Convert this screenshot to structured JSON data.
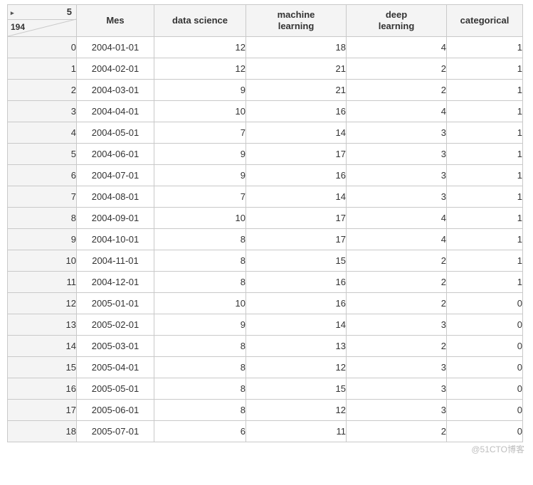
{
  "corner": {
    "tri_glyph": "▸",
    "top_right": "5",
    "row_count": "194"
  },
  "columns": {
    "mes": "Mes",
    "ds": "data science",
    "ml_l1": "machine",
    "ml_l2": "learning",
    "dl_l1": "deep",
    "dl_l2": "learning",
    "cat": "categorical"
  },
  "rows": [
    {
      "idx": "0",
      "mes": "2004-01-01",
      "ds": "12",
      "ml": "18",
      "dl": "4",
      "cat": "1"
    },
    {
      "idx": "1",
      "mes": "2004-02-01",
      "ds": "12",
      "ml": "21",
      "dl": "2",
      "cat": "1"
    },
    {
      "idx": "2",
      "mes": "2004-03-01",
      "ds": "9",
      "ml": "21",
      "dl": "2",
      "cat": "1"
    },
    {
      "idx": "3",
      "mes": "2004-04-01",
      "ds": "10",
      "ml": "16",
      "dl": "4",
      "cat": "1"
    },
    {
      "idx": "4",
      "mes": "2004-05-01",
      "ds": "7",
      "ml": "14",
      "dl": "3",
      "cat": "1"
    },
    {
      "idx": "5",
      "mes": "2004-06-01",
      "ds": "9",
      "ml": "17",
      "dl": "3",
      "cat": "1"
    },
    {
      "idx": "6",
      "mes": "2004-07-01",
      "ds": "9",
      "ml": "16",
      "dl": "3",
      "cat": "1"
    },
    {
      "idx": "7",
      "mes": "2004-08-01",
      "ds": "7",
      "ml": "14",
      "dl": "3",
      "cat": "1"
    },
    {
      "idx": "8",
      "mes": "2004-09-01",
      "ds": "10",
      "ml": "17",
      "dl": "4",
      "cat": "1"
    },
    {
      "idx": "9",
      "mes": "2004-10-01",
      "ds": "8",
      "ml": "17",
      "dl": "4",
      "cat": "1"
    },
    {
      "idx": "10",
      "mes": "2004-11-01",
      "ds": "8",
      "ml": "15",
      "dl": "2",
      "cat": "1"
    },
    {
      "idx": "11",
      "mes": "2004-12-01",
      "ds": "8",
      "ml": "16",
      "dl": "2",
      "cat": "1"
    },
    {
      "idx": "12",
      "mes": "2005-01-01",
      "ds": "10",
      "ml": "16",
      "dl": "2",
      "cat": "0"
    },
    {
      "idx": "13",
      "mes": "2005-02-01",
      "ds": "9",
      "ml": "14",
      "dl": "3",
      "cat": "0"
    },
    {
      "idx": "14",
      "mes": "2005-03-01",
      "ds": "8",
      "ml": "13",
      "dl": "2",
      "cat": "0"
    },
    {
      "idx": "15",
      "mes": "2005-04-01",
      "ds": "8",
      "ml": "12",
      "dl": "3",
      "cat": "0"
    },
    {
      "idx": "16",
      "mes": "2005-05-01",
      "ds": "8",
      "ml": "15",
      "dl": "3",
      "cat": "0"
    },
    {
      "idx": "17",
      "mes": "2005-06-01",
      "ds": "8",
      "ml": "12",
      "dl": "3",
      "cat": "0"
    },
    {
      "idx": "18",
      "mes": "2005-07-01",
      "ds": "6",
      "ml": "11",
      "dl": "2",
      "cat": "0"
    }
  ],
  "watermark": "@51CTO博客"
}
